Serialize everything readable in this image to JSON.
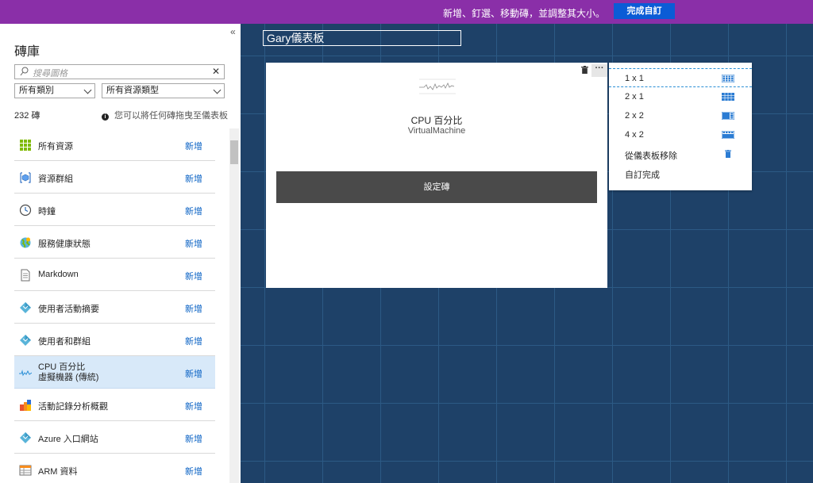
{
  "topbar": {
    "hint": "新增、釘選、移動磚，並調整其大小。",
    "done_button": "完成自訂"
  },
  "panel": {
    "collapse": "«",
    "title": "磚庫",
    "search_placeholder": "搜尋圖格",
    "clear": "✕",
    "category_select": "所有類別",
    "resource_select": "所有資源類型",
    "count": "232 磚",
    "info": "您可以將任何磚拖曳至儀表板",
    "items": [
      {
        "label": "所有資源",
        "add": "新增",
        "icon": "grid-icon"
      },
      {
        "label": "資源群組",
        "add": "新增",
        "icon": "cube-icon"
      },
      {
        "label": "時鐘",
        "add": "新增",
        "icon": "clock-icon"
      },
      {
        "label": "服務健康狀態",
        "add": "新增",
        "icon": "globe-icon"
      },
      {
        "label": "Markdown",
        "add": "新增",
        "icon": "document-icon"
      },
      {
        "label": "使用者活動摘要",
        "add": "新增",
        "icon": "diamond-icon"
      },
      {
        "label": "使用者和群組",
        "add": "新增",
        "icon": "diamond-icon"
      },
      {
        "label": "CPU 百分比",
        "sublabel": "虛擬機器 (傳統)",
        "add": "新增",
        "icon": "sparkline-icon"
      },
      {
        "label": "活動記錄分析概觀",
        "add": "新增",
        "icon": "analytics-icon"
      },
      {
        "label": "Azure 入口網站",
        "add": "新增",
        "icon": "diamond-icon"
      },
      {
        "label": "ARM 資料",
        "add": "新增",
        "icon": "table-icon"
      }
    ]
  },
  "dashboard": {
    "title": "Gary儀表板"
  },
  "tile": {
    "title": "CPU 百分比",
    "subtitle": "VirtualMachine",
    "more": "···",
    "config_button": "設定磚"
  },
  "menu": {
    "items": [
      {
        "label": "1 x 1",
        "icon": "size-1x1-icon"
      },
      {
        "label": "2 x 1",
        "icon": "size-2x1-icon"
      },
      {
        "label": "2 x 2",
        "icon": "size-2x2-icon"
      },
      {
        "label": "4 x 2",
        "icon": "size-4x2-icon"
      },
      {
        "label": "從儀表板移除",
        "icon": "trash-icon"
      },
      {
        "label": "自訂完成",
        "icon": ""
      }
    ]
  },
  "colors": {
    "topbar": "#8a2fa8",
    "accent": "#0b5cd6",
    "link": "#0a62c4",
    "dashboard_bg": "#1e4168"
  }
}
